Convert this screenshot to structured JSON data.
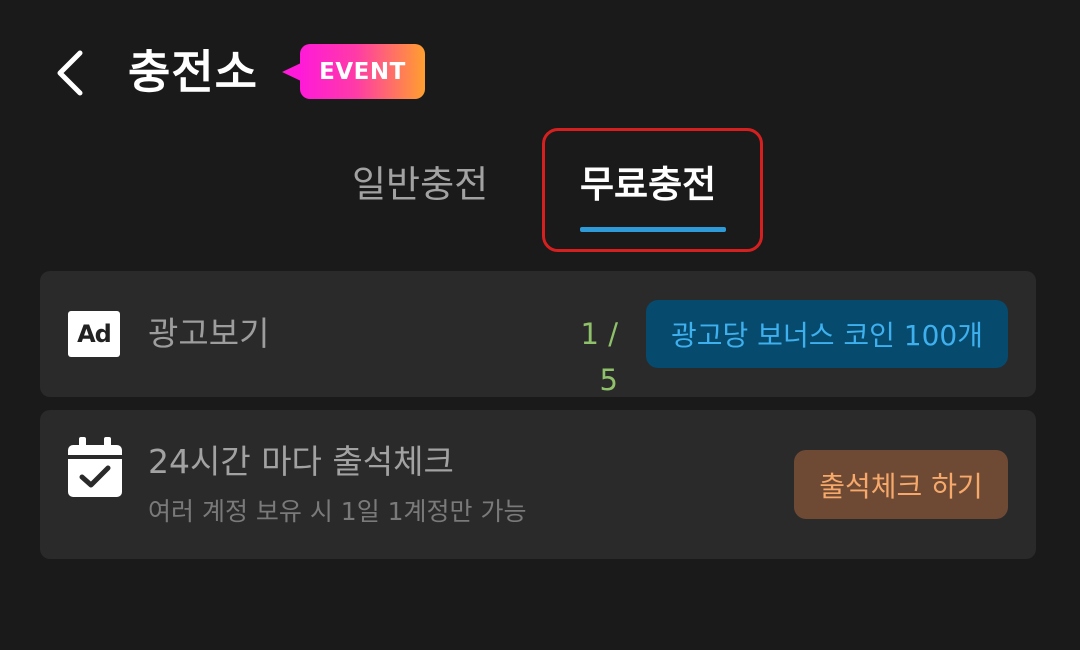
{
  "header": {
    "title": "충전소",
    "badge": "EVENT",
    "back_icon": "chevron-left-icon"
  },
  "tabs": [
    {
      "label": "일반충전",
      "selected": false
    },
    {
      "label": "무료충전",
      "selected": true
    }
  ],
  "colors": {
    "background": "#1a1a1a",
    "card": "#2a2a2a",
    "tab_underline": "#2f9ad8",
    "highlight_border": "#d62020",
    "ad_button_bg": "#064a6e",
    "ad_button_text": "#3fb0ee",
    "check_button_bg": "#6e4a35",
    "check_button_text": "#f6a96a",
    "count_text": "#8fc06a"
  },
  "ad_watch": {
    "icon": "ad-icon",
    "icon_text": "Ad",
    "label": "광고보기",
    "count": "1 / 5",
    "button_label": "광고당 보너스 코인 100개"
  },
  "attendance": {
    "icon": "calendar-check-icon",
    "title": "24시간 마다 출석체크",
    "subtitle": "여러 계정 보유 시 1일 1계정만 가능",
    "button_label": "출석체크 하기"
  }
}
